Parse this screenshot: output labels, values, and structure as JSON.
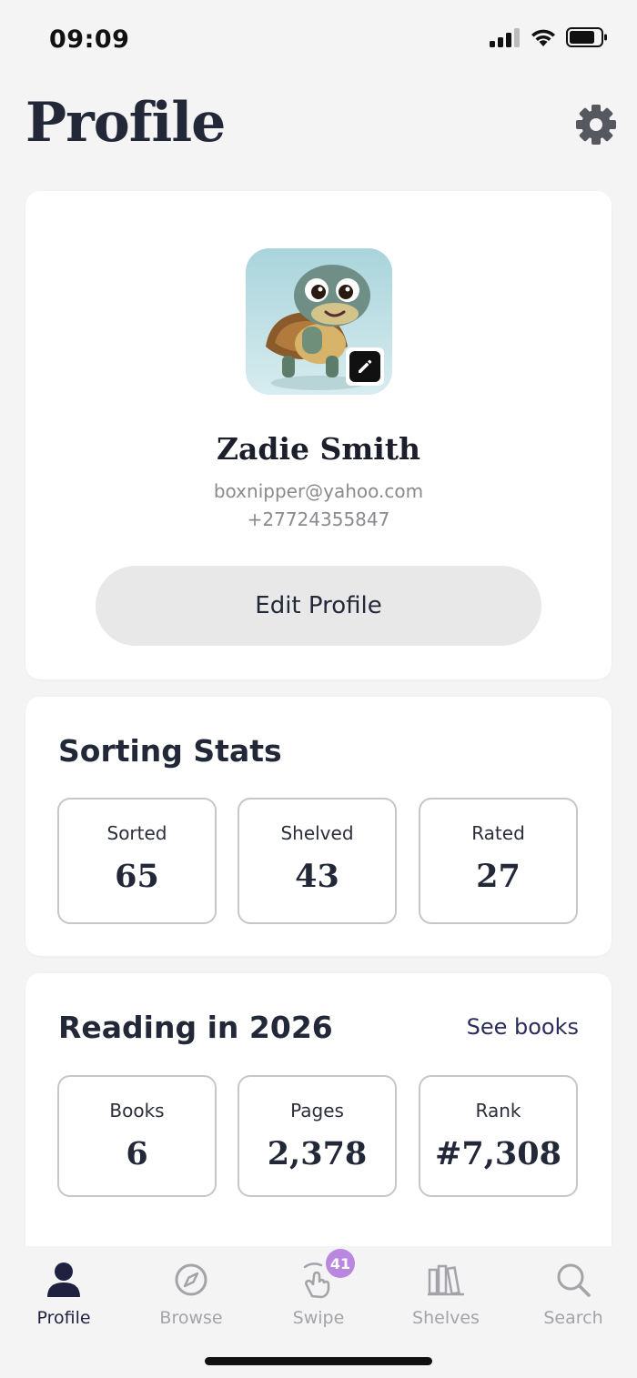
{
  "status_bar": {
    "time": "09:09"
  },
  "header": {
    "title": "Profile"
  },
  "profile": {
    "name": "Zadie Smith",
    "email": "boxnipper@yahoo.com",
    "phone": "+27724355847",
    "edit_button_label": "Edit Profile"
  },
  "sorting_stats": {
    "title": "Sorting Stats",
    "items": [
      {
        "label": "Sorted",
        "value": "65"
      },
      {
        "label": "Shelved",
        "value": "43"
      },
      {
        "label": "Rated",
        "value": "27"
      }
    ]
  },
  "reading": {
    "title": "Reading in 2026",
    "link_label": "See books",
    "items": [
      {
        "label": "Books",
        "value": "6"
      },
      {
        "label": "Pages",
        "value": "2,378"
      },
      {
        "label": "Rank",
        "value": "#7,308"
      }
    ]
  },
  "tab_bar": {
    "items": [
      {
        "label": "Profile",
        "icon": "person-icon",
        "active": true
      },
      {
        "label": "Browse",
        "icon": "compass-icon",
        "active": false
      },
      {
        "label": "Swipe",
        "icon": "swipe-hand-icon",
        "active": false,
        "badge": "41"
      },
      {
        "label": "Shelves",
        "icon": "books-icon",
        "active": false
      },
      {
        "label": "Search",
        "icon": "search-icon",
        "active": false
      }
    ]
  },
  "colors": {
    "background": "#f4f4f5",
    "card": "#ffffff",
    "primary_text": "#232838",
    "muted_text": "#8a8a8f",
    "active_tab": "#1f2140",
    "badge": "#b987e0"
  }
}
